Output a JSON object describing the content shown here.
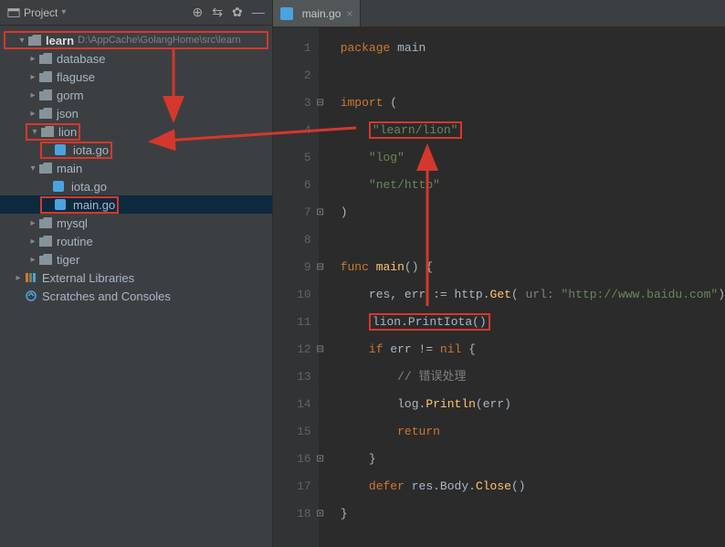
{
  "sidebar": {
    "title": "Project",
    "root": {
      "name": "learn",
      "path": "D:\\AppCache\\GolangHome\\src\\learn"
    },
    "tree": [
      {
        "label": "database",
        "type": "folder",
        "indent": 1,
        "expanded": false
      },
      {
        "label": "flaguse",
        "type": "folder",
        "indent": 1,
        "expanded": false
      },
      {
        "label": "gorm",
        "type": "folder",
        "indent": 1,
        "expanded": false
      },
      {
        "label": "json",
        "type": "folder",
        "indent": 1,
        "expanded": false
      },
      {
        "label": "lion",
        "type": "folder",
        "indent": 1,
        "expanded": true,
        "redbox": true
      },
      {
        "label": "iota.go",
        "type": "gofile",
        "indent": 2,
        "redbox": true
      },
      {
        "label": "main",
        "type": "folder",
        "indent": 1,
        "expanded": true
      },
      {
        "label": "iota.go",
        "type": "gofile",
        "indent": 2
      },
      {
        "label": "main.go",
        "type": "gofile",
        "indent": 2,
        "selected": true,
        "redbox": true
      },
      {
        "label": "mysql",
        "type": "folder",
        "indent": 1,
        "expanded": false
      },
      {
        "label": "routine",
        "type": "folder",
        "indent": 1,
        "expanded": false
      },
      {
        "label": "tiger",
        "type": "folder",
        "indent": 1,
        "expanded": false
      },
      {
        "label": "External Libraries",
        "type": "lib",
        "indent": 0,
        "expanded": false
      },
      {
        "label": "Scratches and Consoles",
        "type": "scratch",
        "indent": 0
      }
    ]
  },
  "tabs": [
    {
      "label": "main.go",
      "active": true
    }
  ],
  "code": {
    "lines": [
      {
        "n": 1,
        "tokens": [
          {
            "t": "package ",
            "c": "kw"
          },
          {
            "t": "main",
            "c": "pkg"
          }
        ]
      },
      {
        "n": 2,
        "tokens": []
      },
      {
        "n": 3,
        "tokens": [
          {
            "t": "import ",
            "c": "kw"
          },
          {
            "t": "(",
            "c": "pkg"
          }
        ],
        "foldOpen": true
      },
      {
        "n": 4,
        "tokens": [
          {
            "t": "    ",
            "c": ""
          },
          {
            "t": "\"learn/lion\"",
            "c": "str",
            "redbox": true
          }
        ]
      },
      {
        "n": 5,
        "tokens": [
          {
            "t": "    ",
            "c": ""
          },
          {
            "t": "\"log\"",
            "c": "str"
          }
        ]
      },
      {
        "n": 6,
        "tokens": [
          {
            "t": "    ",
            "c": ""
          },
          {
            "t": "\"net/http\"",
            "c": "str"
          }
        ]
      },
      {
        "n": 7,
        "tokens": [
          {
            "t": ")",
            "c": "pkg"
          }
        ],
        "foldClose": true
      },
      {
        "n": 8,
        "tokens": []
      },
      {
        "n": 9,
        "tokens": [
          {
            "t": "func ",
            "c": "kw"
          },
          {
            "t": "main",
            "c": "fn"
          },
          {
            "t": "() {",
            "c": "pkg"
          }
        ],
        "foldOpen": true,
        "run": true
      },
      {
        "n": 10,
        "tokens": [
          {
            "t": "    res, err := http.",
            "c": "pkg"
          },
          {
            "t": "Get",
            "c": "fn"
          },
          {
            "t": "( ",
            "c": "pkg"
          },
          {
            "t": "url: ",
            "c": "param"
          },
          {
            "t": "\"http://www.baidu.com\"",
            "c": "str"
          },
          {
            "t": ")",
            "c": "pkg"
          }
        ]
      },
      {
        "n": 11,
        "tokens": [
          {
            "t": "    ",
            "c": ""
          },
          {
            "t": "lion.PrintIota()",
            "c": "pkg",
            "redbox": true
          }
        ]
      },
      {
        "n": 12,
        "tokens": [
          {
            "t": "    ",
            "c": ""
          },
          {
            "t": "if ",
            "c": "kw"
          },
          {
            "t": "err != ",
            "c": "pkg"
          },
          {
            "t": "nil ",
            "c": "kw"
          },
          {
            "t": "{",
            "c": "pkg"
          }
        ],
        "foldOpen": true
      },
      {
        "n": 13,
        "tokens": [
          {
            "t": "        ",
            "c": ""
          },
          {
            "t": "// 错误处理",
            "c": "cmt"
          }
        ]
      },
      {
        "n": 14,
        "tokens": [
          {
            "t": "        log.",
            "c": "pkg"
          },
          {
            "t": "Println",
            "c": "fn"
          },
          {
            "t": "(err)",
            "c": "pkg"
          }
        ]
      },
      {
        "n": 15,
        "tokens": [
          {
            "t": "        ",
            "c": ""
          },
          {
            "t": "return",
            "c": "kw"
          }
        ]
      },
      {
        "n": 16,
        "tokens": [
          {
            "t": "    }",
            "c": "pkg"
          }
        ],
        "foldClose": true
      },
      {
        "n": 17,
        "tokens": [
          {
            "t": "    ",
            "c": ""
          },
          {
            "t": "defer ",
            "c": "kw"
          },
          {
            "t": "res.Body.",
            "c": "pkg"
          },
          {
            "t": "Close",
            "c": "fn"
          },
          {
            "t": "()",
            "c": "pkg"
          }
        ]
      },
      {
        "n": 18,
        "tokens": [
          {
            "t": "}",
            "c": "pkg"
          }
        ],
        "foldClose": true
      }
    ]
  }
}
